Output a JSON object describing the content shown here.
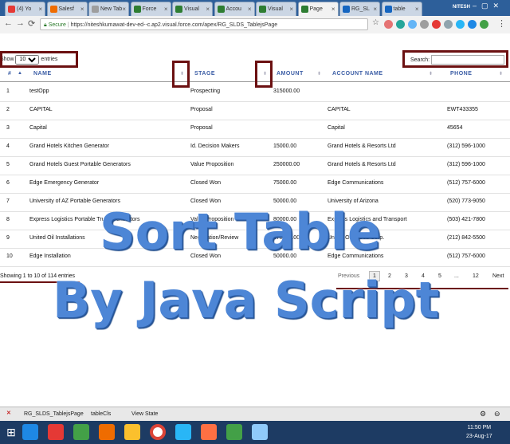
{
  "browser": {
    "tabs": [
      {
        "label": "(4) Yo",
        "color": "#e53935"
      },
      {
        "label": "Salesf",
        "color": "#ef6c00"
      },
      {
        "label": "New Tab",
        "color": "#9e9e9e"
      },
      {
        "label": "Force",
        "color": "#2e7d32"
      },
      {
        "label": "Visual",
        "color": "#2e7d32"
      },
      {
        "label": "Accou",
        "color": "#2e7d32"
      },
      {
        "label": "Visual",
        "color": "#2e7d32"
      },
      {
        "label": "Page",
        "color": "#2e7d32"
      },
      {
        "label": "RG_SL",
        "color": "#1565c0"
      },
      {
        "label": "table",
        "color": "#1565c0"
      }
    ],
    "active_tab_index": 7,
    "profile": "NITESH",
    "secure_label": "Secure",
    "url": "https://niteshkumawat-dev-ed--c.ap2.visual.force.com/apex/RG_SLDS_TablejsPage"
  },
  "table": {
    "length_prefix": "Show",
    "length_value": "10",
    "length_suffix": "entries",
    "search_label": "Search:",
    "search_value": "",
    "columns": [
      "#",
      "NAME",
      "STAGE",
      "AMOUNT",
      "ACCOUNT NAME",
      "PHONE"
    ],
    "rows": [
      [
        "1",
        "testOpp",
        "Prospecting",
        "315000.00",
        "",
        ""
      ],
      [
        "2",
        "CAPITAL",
        "Proposal",
        "",
        "CAPITAL",
        "EWT433355"
      ],
      [
        "3",
        "Capital",
        "Proposal",
        "",
        "Capital",
        "45654"
      ],
      [
        "4",
        "Grand Hotels Kitchen Generator",
        "Id. Decision Makers",
        "15000.00",
        "Grand Hotels & Resorts Ltd",
        "(312) 596-1000"
      ],
      [
        "5",
        "Grand Hotels Guest Portable Generators",
        "Value Proposition",
        "250000.00",
        "Grand Hotels & Resorts Ltd",
        "(312) 596-1000"
      ],
      [
        "6",
        "Edge Emergency Generator",
        "Closed Won",
        "75000.00",
        "Edge Communications",
        "(512) 757-6000"
      ],
      [
        "7",
        "University of AZ Portable Generators",
        "Closed Won",
        "50000.00",
        "University of Arizona",
        "(520) 773-9050"
      ],
      [
        "8",
        "Express Logistics Portable Truck Generators",
        "Value Proposition",
        "80000.00",
        "Express Logistics and Transport",
        "(503) 421-7800"
      ],
      [
        "9",
        "United Oil Installations",
        "Negotiation/Review",
        "270000.00",
        "United Oil & Gas Corp.",
        "(212) 842-5500"
      ],
      [
        "10",
        "Edge Installation",
        "Closed Won",
        "50000.00",
        "Edge Communications",
        "(512) 757-6000"
      ]
    ],
    "info": "Showing 1 to 10 of 114 entries",
    "pagination": [
      "Previous",
      "1",
      "2",
      "3",
      "4",
      "5",
      "...",
      "12",
      "Next"
    ]
  },
  "overlay": {
    "line1": "Sort Table",
    "line2": "By Java Script"
  },
  "devbar": {
    "items": [
      "RG_SLDS_TablejsPage",
      "tableCls",
      "View State"
    ]
  },
  "taskbar": {
    "time": "11:50 PM",
    "date": "23-Aug-17",
    "icons": [
      "start-icon",
      "ie-icon",
      "media-icon",
      "chart-icon",
      "firefox-icon",
      "folder-icon",
      "chrome-icon",
      "skype-icon",
      "postman-icon",
      "whatsapp-icon",
      "notepad-icon"
    ]
  },
  "colors": {
    "highlight": "#6b1011",
    "header_text": "#3b5da5",
    "overlay": "#4d86d6",
    "chrome_frame": "#2d5f9a",
    "taskbar": "#1d3b63"
  }
}
